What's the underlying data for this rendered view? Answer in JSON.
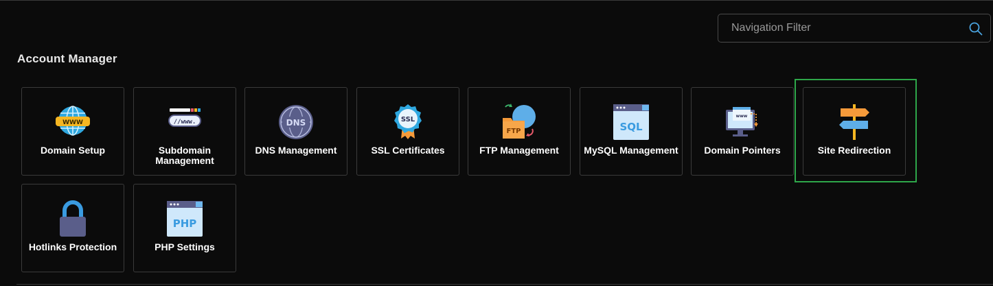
{
  "search": {
    "placeholder": "Navigation Filter"
  },
  "section": {
    "title": "Account Manager"
  },
  "tiles": [
    {
      "label": "Domain Setup",
      "icon": "globe-www-icon"
    },
    {
      "label": "Subdomain Management",
      "icon": "subdomain-www-icon"
    },
    {
      "label": "DNS Management",
      "icon": "dns-globe-icon"
    },
    {
      "label": "SSL Certificates",
      "icon": "ssl-badge-icon"
    },
    {
      "label": "FTP Management",
      "icon": "ftp-folder-icon"
    },
    {
      "label": "MySQL Management",
      "icon": "sql-window-icon"
    },
    {
      "label": "Domain Pointers",
      "icon": "monitor-www-icon"
    },
    {
      "label": "Site Redirection",
      "icon": "signpost-icon"
    },
    {
      "label": "Hotlinks Protection",
      "icon": "padlock-icon"
    },
    {
      "label": "PHP Settings",
      "icon": "php-window-icon"
    }
  ],
  "highlighted_tile": "Site Redirection",
  "colors": {
    "background": "#0b0b0b",
    "tile_border": "#3b3b3b",
    "highlight": "#2ea84a",
    "search_icon": "#4aa3df"
  }
}
